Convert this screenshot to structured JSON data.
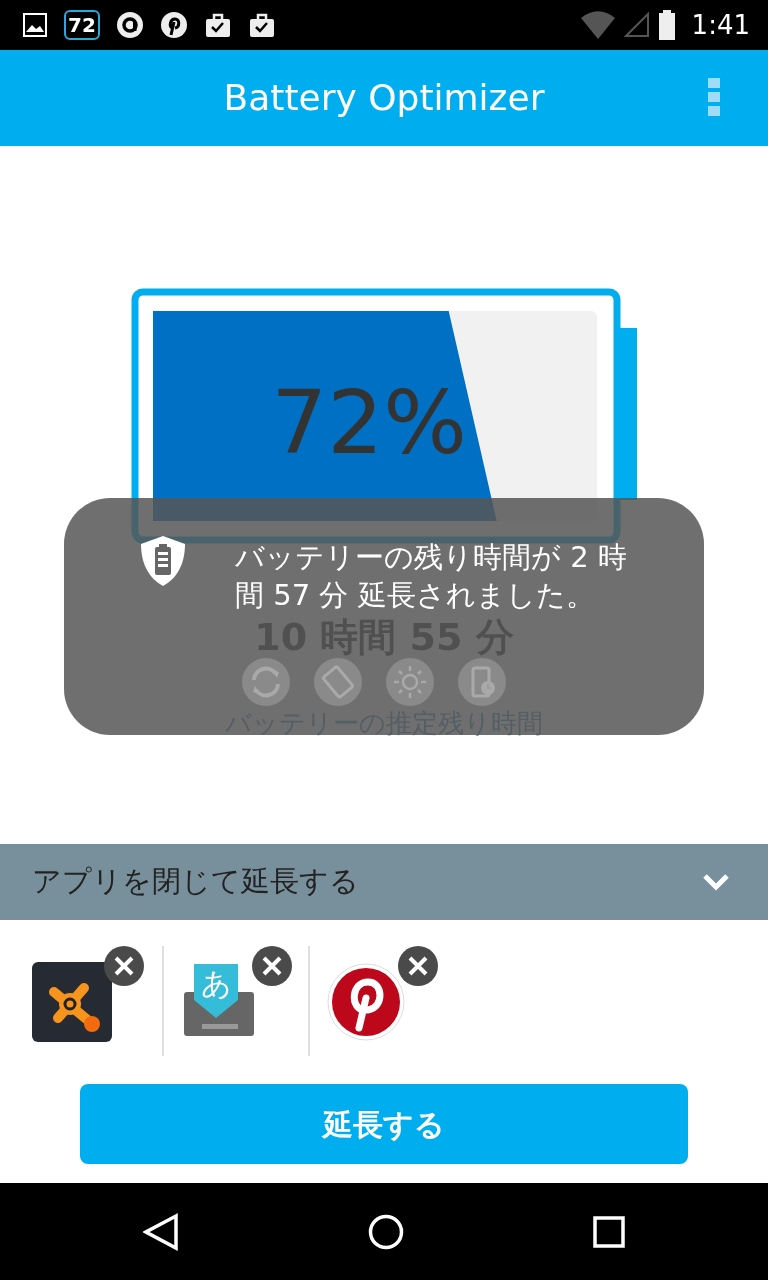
{
  "status_bar": {
    "notification_count": "72",
    "time": "1:41"
  },
  "app_bar": {
    "title": "Battery Optimizer"
  },
  "battery": {
    "level": 0.72,
    "percent": "72%",
    "estimated_time": "10 時間 55 分",
    "estimated_label": "バッテリーの推定残り時間"
  },
  "toast": {
    "message": "バッテリーの残り時間が 2 時間 57 分 延長されました。"
  },
  "close_apps": {
    "title": "アプリを閉じて延長する",
    "apps": [
      {
        "kind": "antivirus"
      },
      {
        "kind": "keyboard",
        "glyph": "あ"
      },
      {
        "kind": "pin"
      }
    ]
  },
  "extend_button": {
    "label": "延長する"
  }
}
